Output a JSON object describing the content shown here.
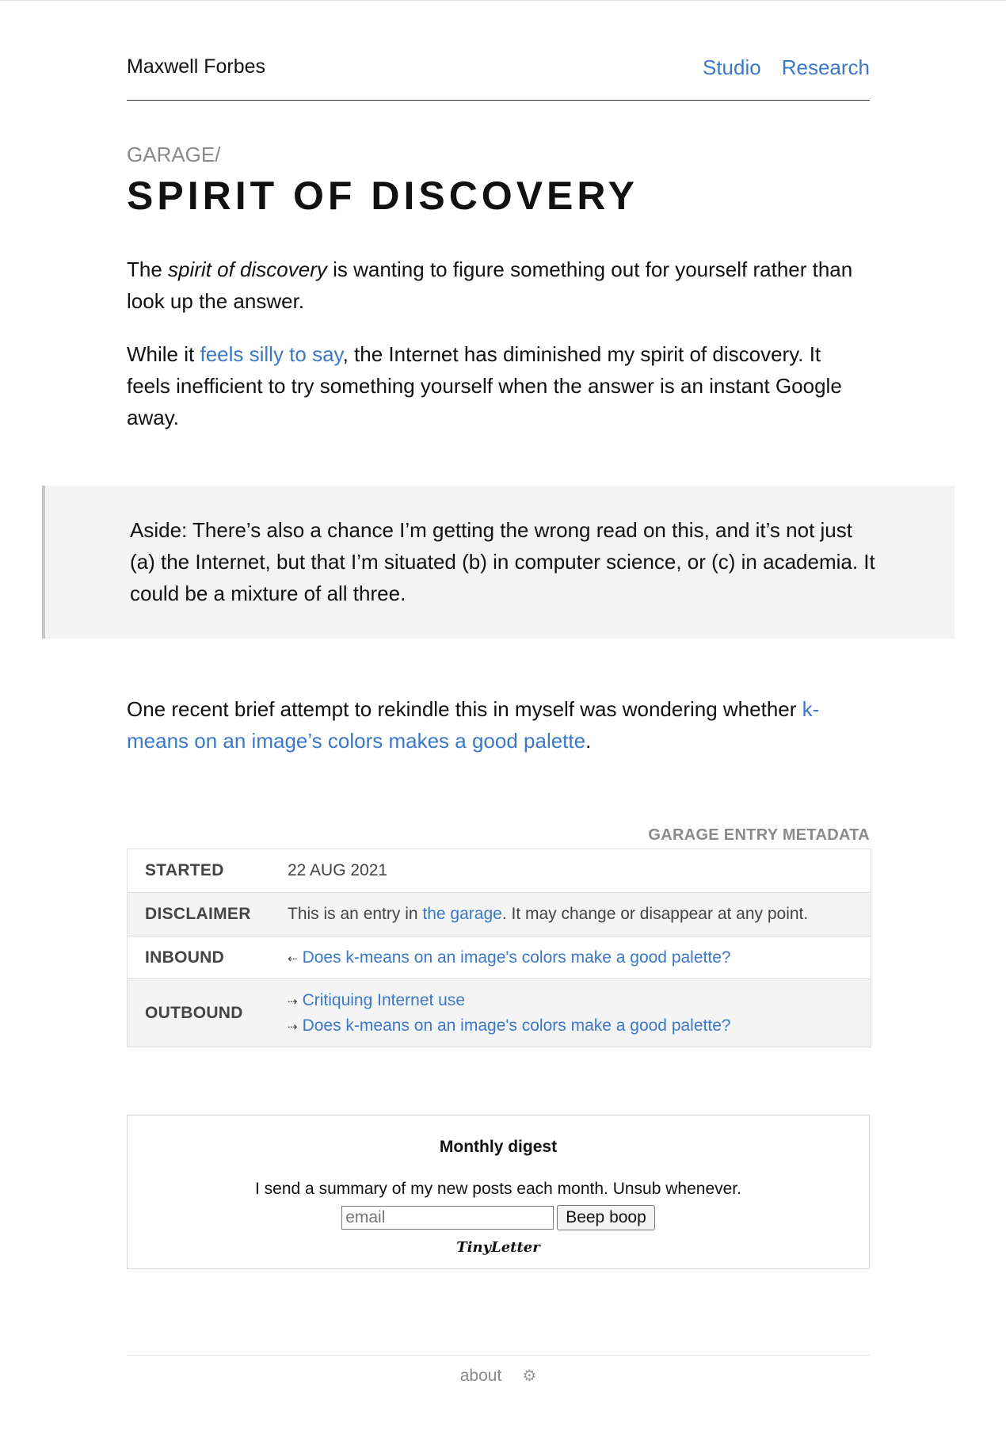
{
  "header": {
    "site_name": "Maxwell Forbes",
    "nav": [
      "Studio",
      "Research"
    ]
  },
  "breadcrumb": "GARAGE/",
  "title": "SPIRIT OF DISCOVERY",
  "paragraph1": {
    "before": "The ",
    "emphasis": "spirit of discovery",
    "after": " is wanting to figure something out for yourself rather than look up the answer."
  },
  "paragraph2": {
    "before": "While it ",
    "link": "feels silly to say",
    "after": ", the Internet has diminished my spirit of discovery. It feels inefficient to try something yourself when the answer is an instant Google away."
  },
  "aside": "Aside: There’s also a chance I’m getting the wrong read on this, and it’s not just (a) the Internet, but that I’m situated (b) in computer science, or (c) in academia. It could be a mixture of all three.",
  "paragraph3": {
    "before": "One recent brief attempt to rekindle this in myself was wondering whether ",
    "link": "k-means on an image’s colors makes a good palette",
    "after": "."
  },
  "metadata": {
    "caption": "GARAGE ENTRY METADATA",
    "started_label": "STARTED",
    "started_value": "22 AUG 2021",
    "disclaimer_label": "DISCLAIMER",
    "disclaimer_before": "This is an entry in ",
    "disclaimer_link": "the garage",
    "disclaimer_after": ". It may change or disappear at any point.",
    "inbound_label": "INBOUND",
    "inbound_links": [
      "Does k-means on an image's colors make a good palette?"
    ],
    "outbound_label": "OUTBOUND",
    "outbound_links": [
      "Critiquing Internet use",
      "Does k-means on an image's colors make a good palette?"
    ]
  },
  "digest": {
    "title": "Monthly digest",
    "text": "I send a summary of my new posts each month. Unsub whenever.",
    "email_placeholder": "email",
    "button_label": "Beep boop",
    "brand": "TinyLetter"
  },
  "footer": {
    "about": "about",
    "gear_icon": "gear-icon"
  }
}
